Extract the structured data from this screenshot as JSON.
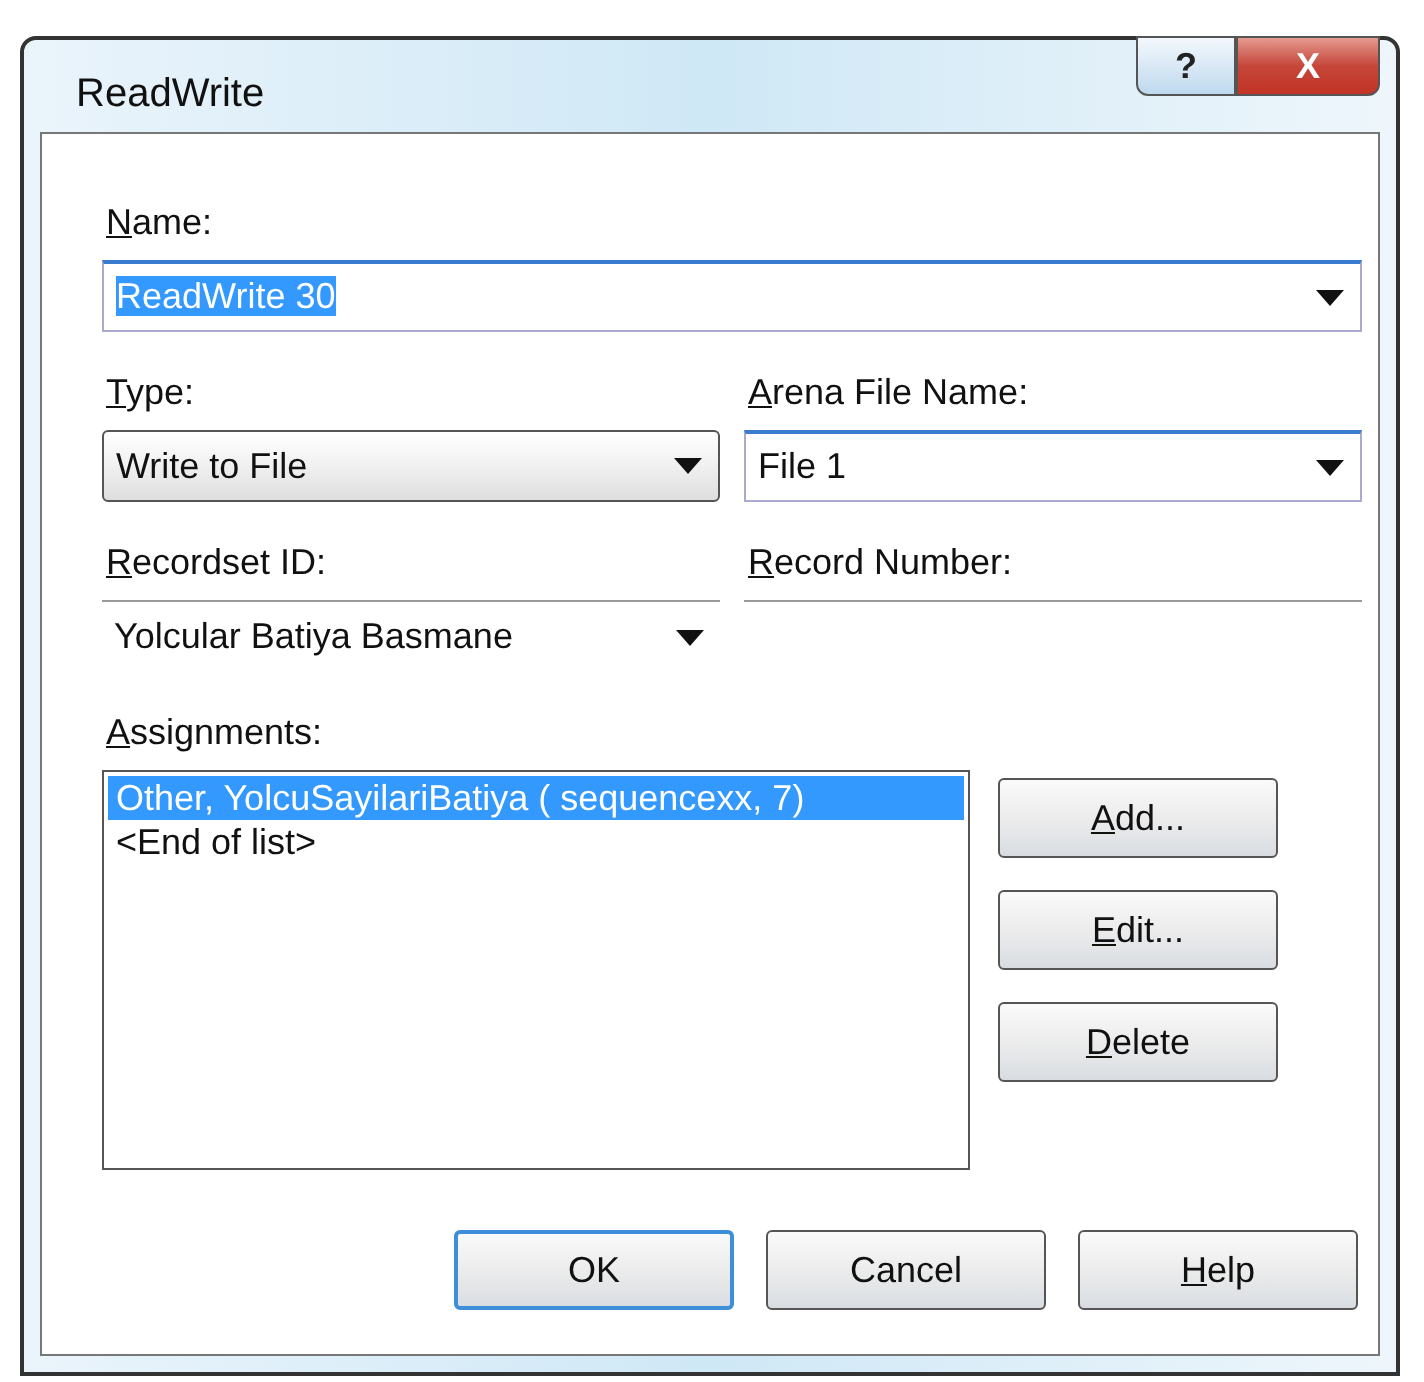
{
  "window": {
    "title": "ReadWrite",
    "controls": [
      {
        "kind": "help",
        "label": "?"
      },
      {
        "kind": "close",
        "label": "X"
      }
    ]
  },
  "name": {
    "label": "Name:",
    "mnemonic": true,
    "value": "ReadWrite 30",
    "text_selected": true,
    "kind": "combo"
  },
  "type": {
    "label": "Type:",
    "mnemonic": true,
    "value": "Write to File",
    "kind": "list"
  },
  "arena_file_name": {
    "label": "Arena File Name:",
    "mnemonic": true,
    "value": "File 1",
    "kind": "combo"
  },
  "recordset_id": {
    "label": "Recordset ID:",
    "mnemonic": true,
    "value": "Yolcular Batiya Basmane",
    "kind": "flat"
  },
  "record_number": {
    "label": "Record Number:",
    "mnemonic": true
  },
  "assignments": {
    "label": "Assignments:",
    "mnemonic": true,
    "items": [
      {
        "text": "Other, YolcuSayilariBatiya ( sequencexx, 7)",
        "selected": true
      },
      {
        "text": "<End of list>",
        "selected": false
      }
    ]
  },
  "side_buttons": [
    {
      "label": "Add...",
      "mnemonic": true
    },
    {
      "label": "Edit...",
      "mnemonic": true
    },
    {
      "label": "Delete",
      "mnemonic": true
    }
  ],
  "buttons": [
    {
      "label": "OK",
      "mnemonic": false,
      "default": true
    },
    {
      "label": "Cancel",
      "mnemonic": false,
      "default": false
    },
    {
      "label": "Help",
      "mnemonic": true,
      "default": false
    }
  ]
}
